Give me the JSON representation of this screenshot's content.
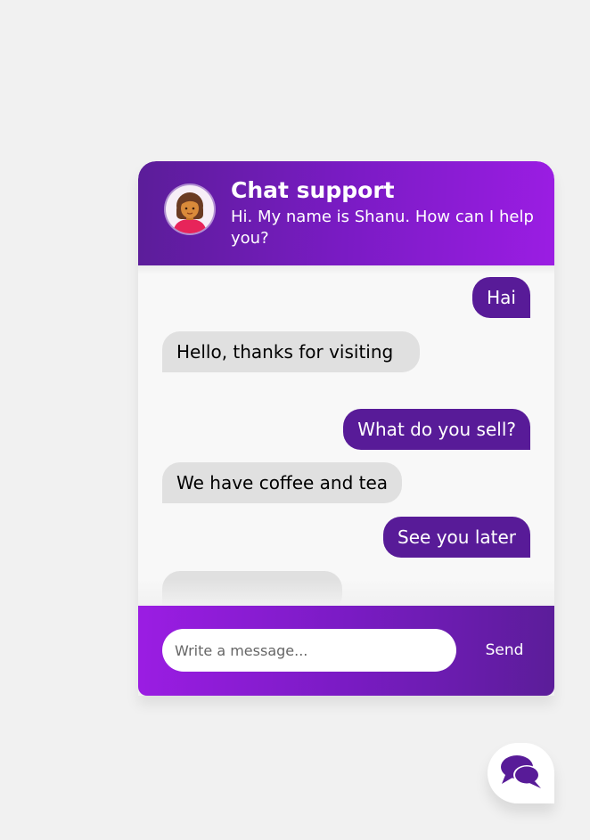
{
  "header": {
    "title": "Chat support",
    "subtitle": "Hi. My name is Shanu. How can I help you?"
  },
  "messages": [
    {
      "sender": "operator",
      "text": "Hai"
    },
    {
      "sender": "visitor",
      "text": "Hello, thanks for visiting"
    },
    {
      "sender": "operator",
      "text": "What do you sell?"
    },
    {
      "sender": "visitor",
      "text": "We have coffee and tea"
    },
    {
      "sender": "operator",
      "text": "See you later"
    },
    {
      "sender": "visitor",
      "text": ""
    }
  ],
  "footer": {
    "input_placeholder": "Write a message...",
    "input_value": "",
    "send_label": "Send"
  },
  "icons": {
    "avatar": "woman-avatar-icon",
    "launcher": "chat-bubbles-icon"
  },
  "colors": {
    "brand_purple": "#581b98",
    "gradient_light": "#9b1de3",
    "gradient_dark": "#5b1d99",
    "visitor_bubble": "#e0e0e0",
    "background": "#f1f1f1"
  }
}
